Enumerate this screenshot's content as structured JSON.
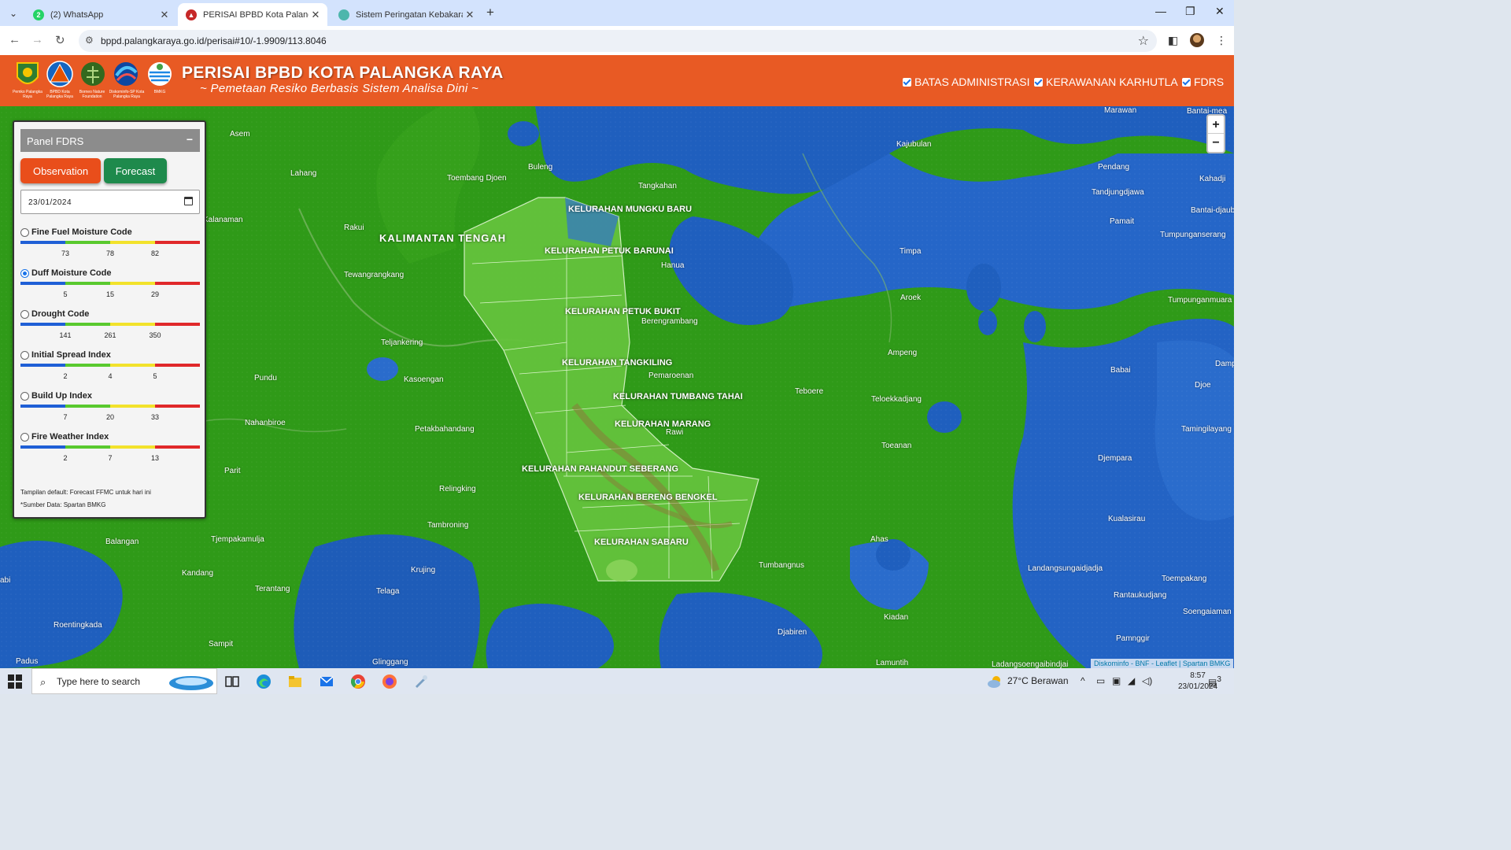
{
  "browser": {
    "tabs": [
      {
        "title": "(2) WhatsApp",
        "icon": "whatsapp-icon",
        "badge": "2"
      },
      {
        "title": "PERISAI BPBD Kota Palangka Raya",
        "icon": "bpbd-icon"
      },
      {
        "title": "Sistem Peringatan Kebakaran Hutan",
        "icon": "globe-icon"
      }
    ],
    "url": "bppd.palangkaraya.go.id/perisai#10/-1.9909/113.8046"
  },
  "header": {
    "logos": [
      "Pemko Palangka Raya",
      "BPBD Kota Palangka Raya",
      "Borneo Nature Foundation",
      "Diskominfo-SP Kota Palangka Raya",
      "BMKG"
    ],
    "title": "PERISAI BPBD KOTA PALANGKA RAYA",
    "subtitle": "~ Pemetaan Resiko Berbasis Sistem Analisa Dini ~",
    "layers": [
      "BATAS ADMINISTRASI",
      "KERAWANAN KARHUTLA",
      "FDRS"
    ]
  },
  "panel": {
    "title": "Panel FDRS",
    "collapse": "−",
    "btn_observation": "Observation",
    "btn_forecast": "Forecast",
    "date": "23/01/2024",
    "indices": [
      {
        "label": "Fine Fuel Moisture Code",
        "ticks": [
          "73",
          "78",
          "82"
        ],
        "selected": false
      },
      {
        "label": "Duff Moisture Code",
        "ticks": [
          "5",
          "15",
          "29"
        ],
        "selected": true
      },
      {
        "label": "Drought Code",
        "ticks": [
          "141",
          "261",
          "350"
        ],
        "selected": false
      },
      {
        "label": "Initial Spread Index",
        "ticks": [
          "2",
          "4",
          "5"
        ],
        "selected": false
      },
      {
        "label": "Build Up Index",
        "ticks": [
          "7",
          "20",
          "33"
        ],
        "selected": false
      },
      {
        "label": "Fire Weather Index",
        "ticks": [
          "2",
          "7",
          "13"
        ],
        "selected": false
      }
    ],
    "scale_colors": [
      "#1f5fd6",
      "#59c92e",
      "#f2e22b",
      "#e0282a"
    ],
    "note1": "Tampilan default: Forecast FFMC untuk hari ini",
    "note2": "*Sumber Data: Spartan BMKG"
  },
  "map": {
    "region_label": "KALIMANTAN TENGAH",
    "kelurahan": [
      "KELURAHAN MUNGKU BARU",
      "KELURAHAN PETUK BARUNAI",
      "KELURAHAN PETUK BUKIT",
      "KELURAHAN TANGKILING",
      "KELURAHAN TUMBANG TAHAI",
      "KELURAHAN MARANG",
      "KELURAHAN PAHANDUT SEBERANG",
      "KELURAHAN BERENG BENGKEL",
      "KELURAHAN SABARU"
    ],
    "places": [
      "Asem",
      "Lahang",
      "Buleng",
      "Toembang Djoen",
      "Tangkahan",
      "Kajubulan",
      "Marawan",
      "Bantai-mea",
      "Pendang",
      "Tandjungdjawa",
      "Kahadji",
      "Bantai-djaub",
      "Pamait",
      "Tumpunganserang",
      "Timpa",
      "Aroek",
      "Tumpunganmuara",
      "Kalanaman",
      "Rakui",
      "Tewangrangkang",
      "Hanua",
      "Berengrambang",
      "Teljankering",
      "Ampeng",
      "Babai",
      "Damp",
      "Pundu",
      "Kasoengan",
      "Pemaroenan",
      "Teboere",
      "Teloekkadjang",
      "Djoe",
      "Nahanbiroe",
      "Rawi",
      "Petakbahandang",
      "Toeanan",
      "Tamingilayang",
      "Parit",
      "Relingking",
      "Djempara",
      "Tambroning",
      "Kualasirau",
      "Balangan",
      "Tjempakamulja",
      "Ahas",
      "Tumbangnus",
      "Kandang",
      "Krujing",
      "Terantang",
      "Telaga",
      "Landangsungaidjadja",
      "Toempakang",
      "Rantaukudjang",
      "Soengaiaman",
      "Roentingkada",
      "Kiadan",
      "Djabiren",
      "Pamnggir",
      "Sampit",
      "Padus",
      "Glinggang",
      "Lamuntih",
      "Ladangsoengaibindjai",
      "abi"
    ],
    "attribution": "Diskominfo - BNF - Leaflet | Spartan BMKG",
    "zoom_in": "+",
    "zoom_out": "−"
  },
  "taskbar": {
    "search_placeholder": "Type here to search",
    "weather": "27°C  Berawan",
    "time": "8:57",
    "date": "23/01/2024",
    "notifications": "3"
  }
}
